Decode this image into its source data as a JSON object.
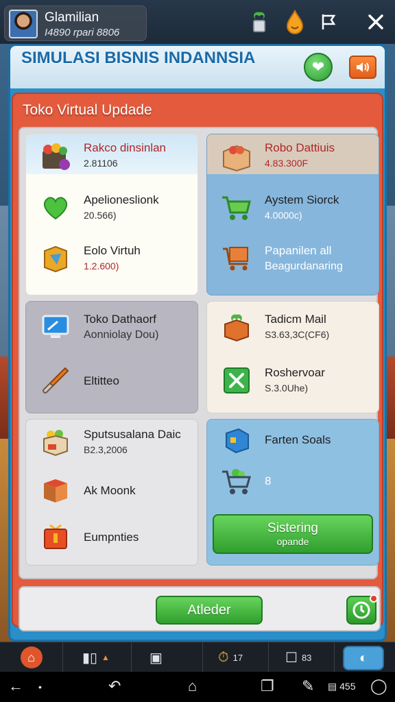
{
  "profile": {
    "name": "Glamilian",
    "money": "I4890 rpari 8806"
  },
  "top_icons": {
    "plant": "plant-pot-icon",
    "drop": "drop-icon",
    "flag": "flag-icon",
    "close": "close-icon"
  },
  "window": {
    "title": "SIMULASI BISNIS INDANNSIA"
  },
  "panel": {
    "title": "Toko Virtual Updade"
  },
  "cards": [
    {
      "items": [
        {
          "name": "Rakco dinsinlan",
          "price": "2.81106",
          "icon": "grocery-box-icon"
        },
        {
          "name": "Apelioneslionk",
          "price": "20.566)",
          "icon": "heart-icon"
        },
        {
          "name": "Eolo Virtuh",
          "price": "1.2.600)",
          "icon": "shield-box-icon"
        }
      ]
    },
    {
      "items": [
        {
          "name": "Robo Dattiuis",
          "price": "4.83.300F",
          "icon": "crate-icon"
        },
        {
          "name": "Aystem Siorck",
          "price": "4.0000c)",
          "icon": "shopping-cart-icon"
        },
        {
          "name": "Papanilen all",
          "price": "Beagurdanaring",
          "icon": "cart-box-icon"
        }
      ]
    },
    {
      "items": [
        {
          "name": "Toko Dathaorf",
          "price": "Aonniolay Dou)",
          "icon": "monitor-icon"
        },
        {
          "name": "Eltitteo",
          "price": "",
          "icon": "paint-brush-icon"
        }
      ]
    },
    {
      "items": [
        {
          "name": "Tadicm Mail",
          "price": "S3.63,3C(CF6)",
          "icon": "plant-box-icon"
        },
        {
          "name": "Roshervoar",
          "price": "S.3.0Uhe)",
          "icon": "x-icon"
        }
      ]
    },
    {
      "items": [
        {
          "name": "Sputsusalana Daic",
          "price": "B2.3,2006",
          "icon": "produce-box-icon"
        },
        {
          "name": "Ak Moonk",
          "price": "",
          "icon": "red-box-icon"
        },
        {
          "name": "Eumpnties",
          "price": "",
          "icon": "gift-bag-icon"
        }
      ]
    },
    {
      "items": [
        {
          "name": "Farten Soals",
          "price": "",
          "icon": "cube-icon"
        },
        {
          "name": "8",
          "price": "",
          "icon": "vegetable-cart-icon"
        }
      ]
    }
  ],
  "sistering_button": {
    "label": "Sistering",
    "sub": "opande"
  },
  "footer": {
    "update_label": "Atleder"
  },
  "gamebar": {
    "stat1": "17",
    "stat2": "83"
  },
  "navbar": {
    "counter": "455"
  }
}
